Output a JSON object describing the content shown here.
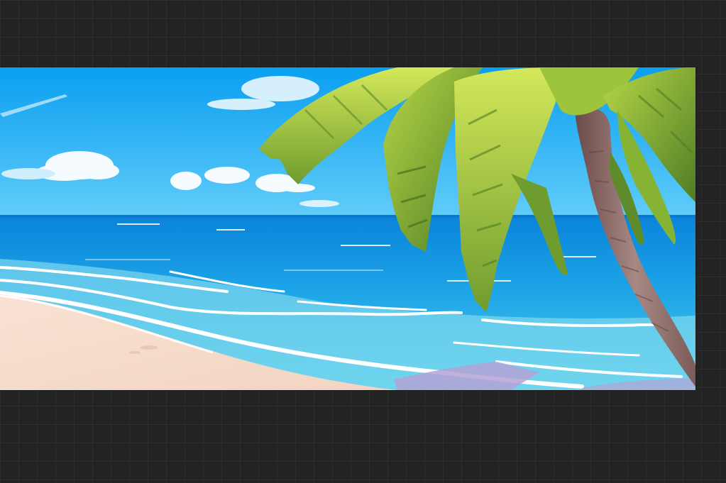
{
  "canvas": {
    "artwork": "tropical-beach-illustration",
    "colors": {
      "sky_top": "#0a9ff0",
      "sky_bottom": "#5cc8f8",
      "sea_far": "#0b86dc",
      "sea_near": "#28b8ec",
      "shallow": "#8ee0f0",
      "foam": "#ffffff",
      "sand": "#f6dccb",
      "shadow": "#b7a6d6",
      "leaf_light": "#c9e04a",
      "leaf_dark": "#5f8c2a",
      "trunk": "#8b6a66"
    }
  }
}
